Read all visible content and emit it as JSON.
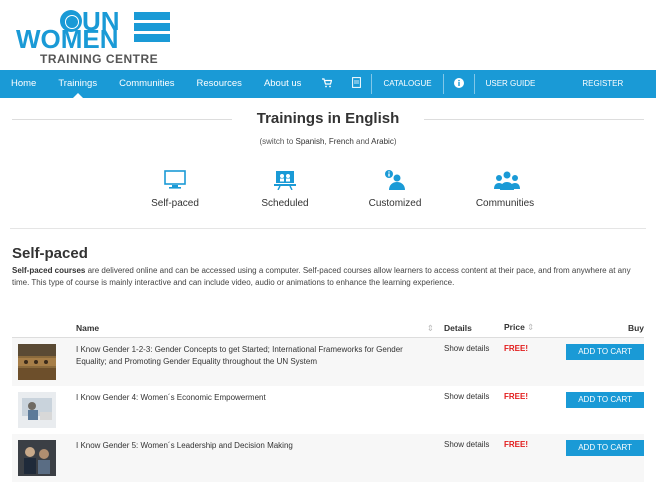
{
  "logo": {
    "un": "UN",
    "women": "WOMEN",
    "subtitle": "TRAINING CENTRE"
  },
  "nav": {
    "items": [
      {
        "label": "Home"
      },
      {
        "label": "Trainings"
      },
      {
        "label": "Communities"
      },
      {
        "label": "Resources"
      },
      {
        "label": "About us"
      }
    ],
    "catalogue": "CATALOGUE",
    "user_guide": "USER GUIDE",
    "register": "REGISTER",
    "cart_icon": "shopping-cart-icon",
    "doc_icon": "document-icon",
    "info_icon": "info-icon"
  },
  "page": {
    "title": "Trainings in English",
    "switch_prefix": "(switch to ",
    "lang_spanish": "Spanish",
    "lang_sep": ", ",
    "lang_french": "French",
    "lang_and": " and ",
    "lang_arabic": "Arabic",
    "switch_suffix": ")"
  },
  "categories": [
    {
      "label": "Self-paced",
      "icon": "monitor-icon"
    },
    {
      "label": "Scheduled",
      "icon": "presentation-icon"
    },
    {
      "label": "Customized",
      "icon": "person-info-icon"
    },
    {
      "label": "Communities",
      "icon": "group-icon"
    }
  ],
  "section": {
    "title": "Self-paced",
    "lead": "Self-paced courses",
    "desc": " are delivered online and can be accessed using a computer. Self-paced courses allow learners to access content at their pace, and from anywhere at any time. This type of course is mainly interactive and can include video, audio or animations to enhance the learning experience."
  },
  "table": {
    "headers": {
      "name": "Name",
      "details": "Details",
      "price": "Price",
      "buy": "Buy"
    },
    "rows": [
      {
        "name": "I Know Gender 1-2-3: Gender Concepts to get Started; International Frameworks for Gender Equality; and Promoting Gender Equality throughout the UN System",
        "details": "Show details",
        "price": "FREE!",
        "buy": "ADD TO CART"
      },
      {
        "name": "I Know Gender 4: Women´s Economic Empowerment",
        "details": "Show details",
        "price": "FREE!",
        "buy": "ADD TO CART"
      },
      {
        "name": "I Know Gender 5: Women´s Leadership and Decision Making",
        "details": "Show details",
        "price": "FREE!",
        "buy": "ADD TO CART"
      }
    ]
  },
  "colors": {
    "accent": "#1a9ad6",
    "price": "#e21b1b"
  }
}
